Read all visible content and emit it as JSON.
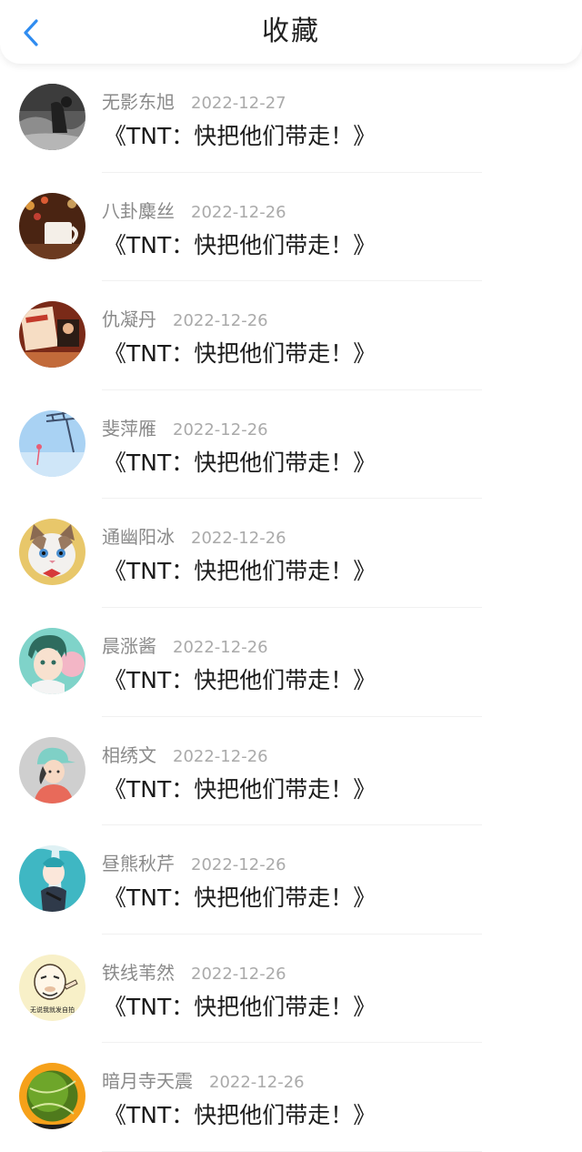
{
  "header": {
    "title": "收藏",
    "back_icon": "chevron-left-icon",
    "accent_color": "#2f8cf0"
  },
  "favorites": [
    {
      "username": "无影东旭",
      "date": "2022-12-27",
      "title": "《TNT：快把他们带走！》",
      "avatar": "avatar-dark-photo"
    },
    {
      "username": "八卦麋丝",
      "date": "2022-12-26",
      "title": "《TNT：快把他们带走！》",
      "avatar": "avatar-mug-lights"
    },
    {
      "username": "仇凝丹",
      "date": "2022-12-26",
      "title": "《TNT：快把他们带走！》",
      "avatar": "avatar-birthday-card"
    },
    {
      "username": "斐萍雁",
      "date": "2022-12-26",
      "title": "《TNT：快把他们带走！》",
      "avatar": "avatar-sky-ferris"
    },
    {
      "username": "通幽阳冰",
      "date": "2022-12-26",
      "title": "《TNT：快把他们带走！》",
      "avatar": "avatar-cat"
    },
    {
      "username": "晨涨酱",
      "date": "2022-12-26",
      "title": "《TNT：快把他们带走！》",
      "avatar": "avatar-anime-boy"
    },
    {
      "username": "相绣文",
      "date": "2022-12-26",
      "title": "《TNT：快把他们带走！》",
      "avatar": "avatar-cartoon-girl-cap"
    },
    {
      "username": "昼熊秋芹",
      "date": "2022-12-26",
      "title": "《TNT：快把他们带走！》",
      "avatar": "avatar-anime-teal-hair"
    },
    {
      "username": "铁线苇然",
      "date": "2022-12-26",
      "title": "《TNT：快把他们带走！》",
      "avatar": "avatar-meme-face",
      "avatar_caption": "无说我就发自拍"
    },
    {
      "username": "暗月寺天震",
      "date": "2022-12-26",
      "title": "《TNT：快把他们带走！》",
      "avatar": "avatar-tennis-ball"
    }
  ]
}
